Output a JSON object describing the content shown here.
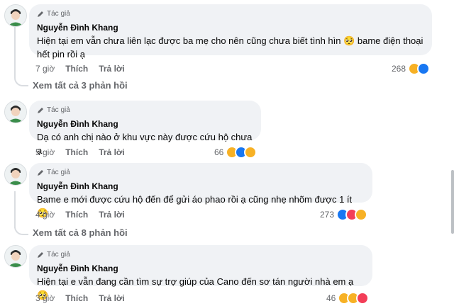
{
  "comments": [
    {
      "role": "Tác giả",
      "name": "Nguyễn Đình Khang",
      "line1": "Hiện tại em vẫn chưa liên lạc được ba mẹ cho nên cũng chưa biết tình hìn 🥺 bame điện thoại",
      "line2": "hết pin rồi ạ",
      "time": "7 giờ",
      "like": "Thích",
      "reply": "Trả lời",
      "reactions": "268",
      "more": "Xem tất cả 3 phản hồi"
    },
    {
      "role": "Tác giả",
      "name": "Nguyễn Đình Khang",
      "line1": "Dạ có anh chị nào ở khu vực này được cứu hộ chưa ạ",
      "time": "5 giờ",
      "like": "Thích",
      "reply": "Trả lời",
      "reactions": "66"
    },
    {
      "role": "Tác giả",
      "name": "Nguyễn Đình Khang",
      "line1": "Bame e mới được cứu hộ đến để gửi áo phao rồi ạ cũng nhẹ nhõm được 1 ít 🥺",
      "time": "4 giờ",
      "like": "Thích",
      "reply": "Trả lời",
      "reactions": "273",
      "more": "Xem tất cả 8 phản hồi"
    },
    {
      "role": "Tác giả",
      "name": "Nguyễn Đình Khang",
      "line1": "Hiện tại e vẫn đang cần tìm sự trợ giúp của Cano đến sơ tán người nhà em ạ 🥺",
      "time": "3 giờ",
      "like": "Thích",
      "reply": "Trả lời",
      "reactions": "46"
    }
  ],
  "colors": {
    "bubble": "#f0f2f5",
    "meta": "#65676b",
    "like": "#1877f2",
    "love": "#f33e58",
    "sad": "#f7b125"
  },
  "icons": {
    "author_badge": "pencil-icon",
    "reactions": [
      "like-icon",
      "sad-icon",
      "care-icon",
      "love-icon"
    ]
  }
}
